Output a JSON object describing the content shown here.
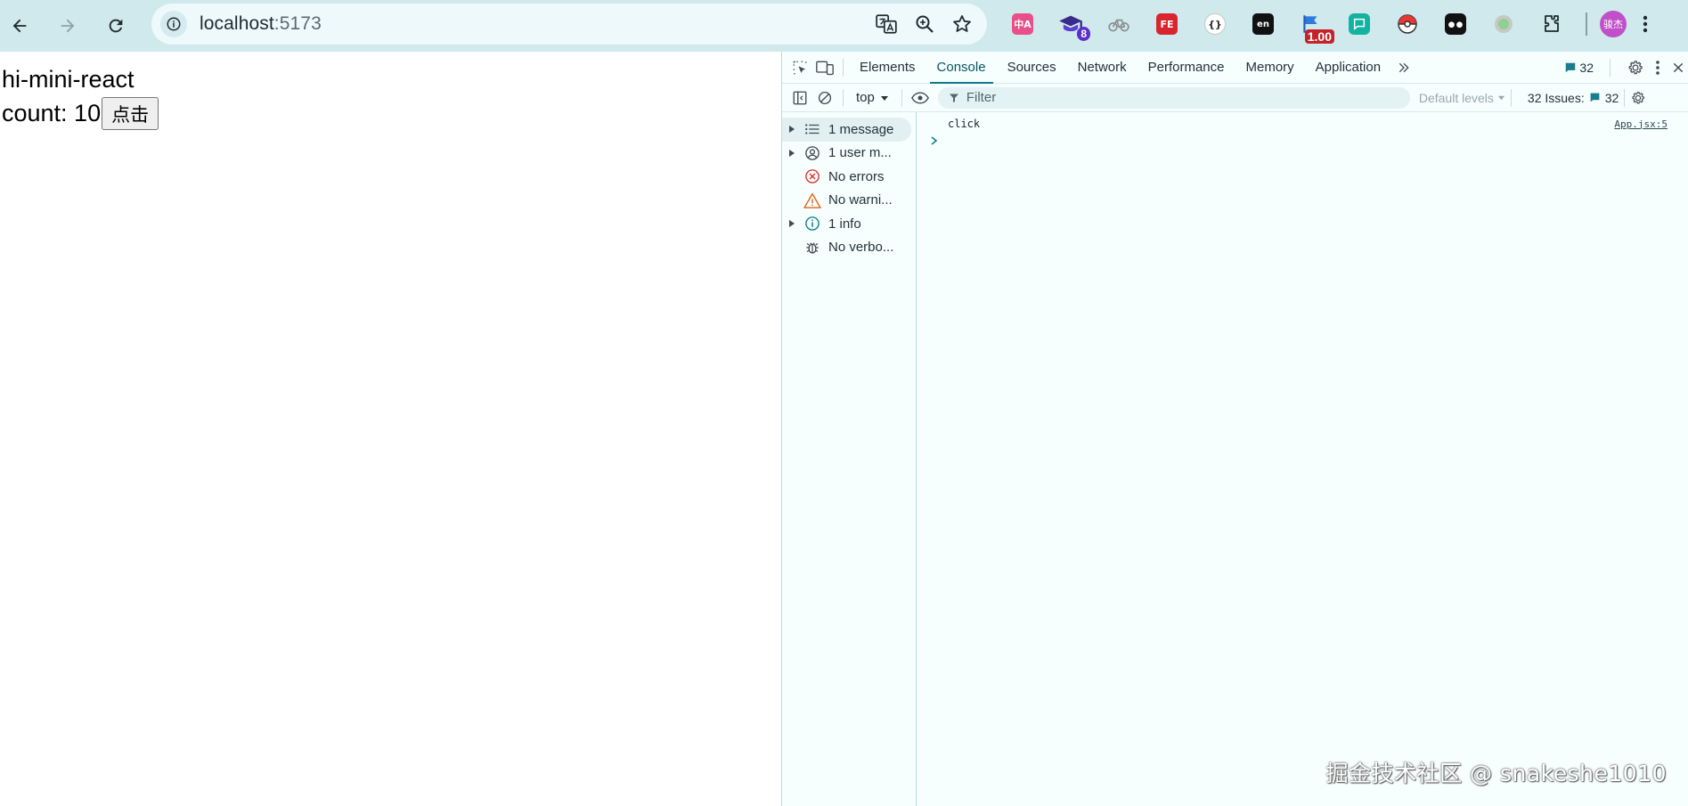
{
  "browser": {
    "url_host": "localhost",
    "url_port": ":5173"
  },
  "page": {
    "title": "hi-mini-react",
    "count_label": "count: 10",
    "button_label": "点击"
  },
  "extensions": {
    "badge_8": "8",
    "badge_price": "1.00",
    "fe_label": "FE",
    "json_label": "{}",
    "avatar_label": "骏杰"
  },
  "devtools": {
    "tabs": [
      "Elements",
      "Console",
      "Sources",
      "Network",
      "Performance",
      "Memory",
      "Application"
    ],
    "active_tab": "Console",
    "issues_badge": "32",
    "context": "top",
    "filter_placeholder": "Filter",
    "levels": "Default levels",
    "issues_label": "32 Issues:",
    "issues_count": "32",
    "sidebar": [
      {
        "label": "1 message",
        "icon": "list-icon",
        "expandable": true
      },
      {
        "label": "1 user m...",
        "icon": "user-icon",
        "expandable": true
      },
      {
        "label": "No errors",
        "icon": "error-icon",
        "expandable": false
      },
      {
        "label": "No warni...",
        "icon": "warning-icon",
        "expandable": false
      },
      {
        "label": "1 info",
        "icon": "info-icon",
        "expandable": true
      },
      {
        "label": "No verbo...",
        "icon": "bug-icon",
        "expandable": false
      }
    ],
    "log": {
      "message": "click",
      "source": "App.jsx:5"
    }
  },
  "watermark": "掘金技术社区 @ snakeshe1010",
  "colors": {
    "toolbar_bg": "#cfe9ec",
    "devtools_bg": "#f6fefe",
    "accent": "#0b7b8a"
  }
}
